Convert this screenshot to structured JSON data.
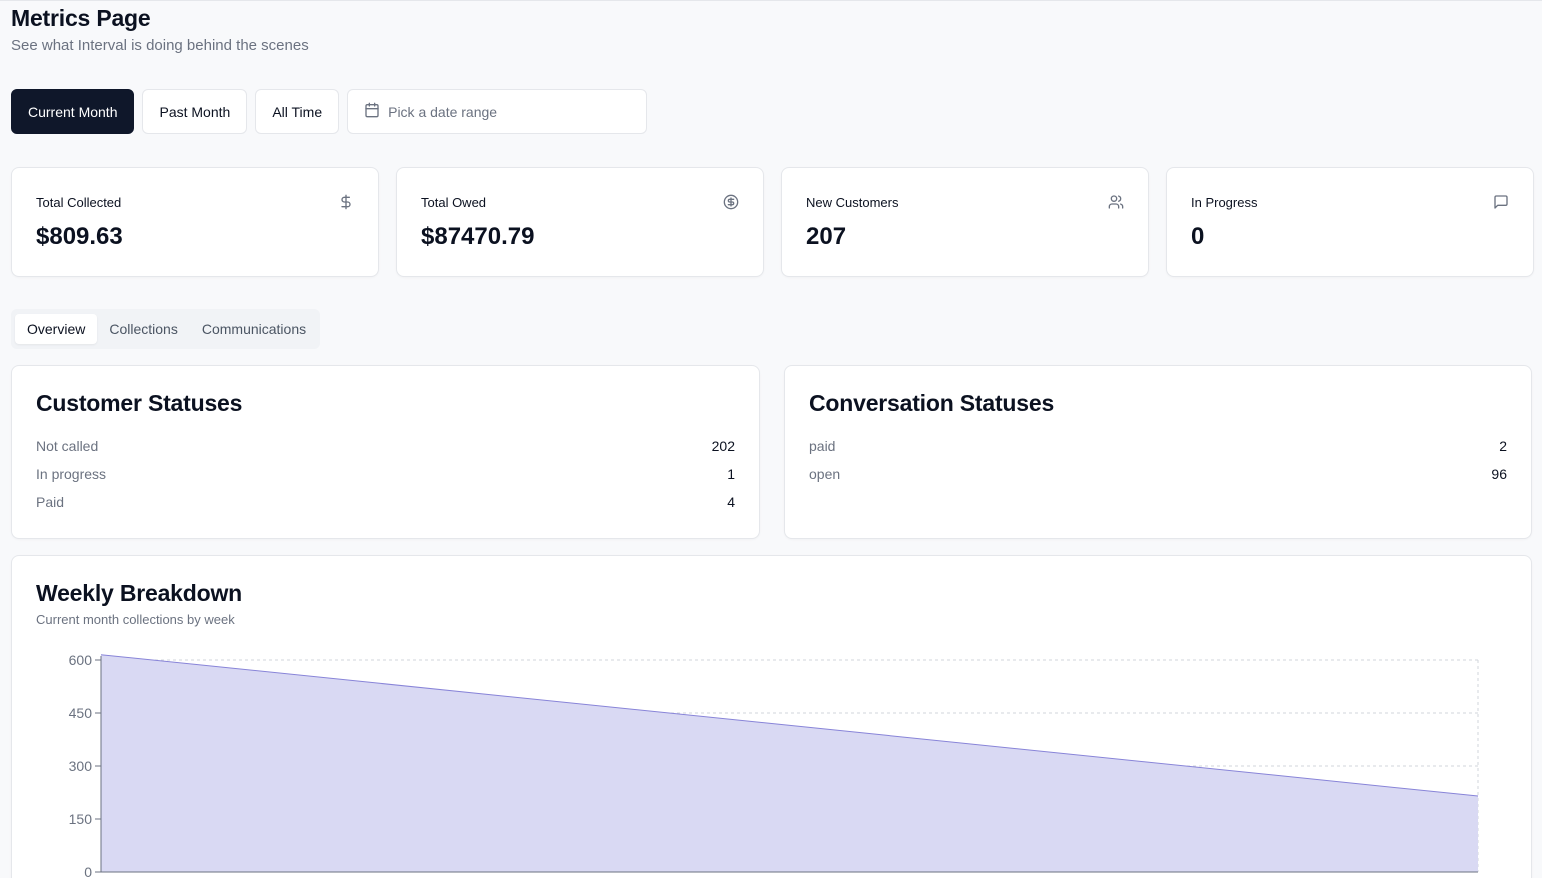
{
  "header": {
    "title": "Metrics Page",
    "subtitle": "See what Interval is doing behind the scenes"
  },
  "filters": {
    "current_month": "Current Month",
    "past_month": "Past Month",
    "all_time": "All Time",
    "date_range_placeholder": "Pick a date range",
    "active": "current_month"
  },
  "stats": [
    {
      "label": "Total Collected",
      "value": "$809.63",
      "icon": "dollar-icon"
    },
    {
      "label": "Total Owed",
      "value": "$87470.79",
      "icon": "dollar-circle-icon"
    },
    {
      "label": "New Customers",
      "value": "207",
      "icon": "users-icon"
    },
    {
      "label": "In Progress",
      "value": "0",
      "icon": "message-square-icon"
    }
  ],
  "tabs": [
    {
      "label": "Overview",
      "active": true
    },
    {
      "label": "Collections",
      "active": false
    },
    {
      "label": "Communications",
      "active": false
    }
  ],
  "customer_statuses": {
    "title": "Customer Statuses",
    "rows": [
      {
        "label": "Not called",
        "value": "202"
      },
      {
        "label": "In progress",
        "value": "1"
      },
      {
        "label": "Paid",
        "value": "4"
      }
    ]
  },
  "conversation_statuses": {
    "title": "Conversation Statuses",
    "rows": [
      {
        "label": "paid",
        "value": "2"
      },
      {
        "label": "open",
        "value": "96"
      }
    ]
  },
  "weekly": {
    "title": "Weekly Breakdown",
    "subtitle": "Current month collections by week"
  },
  "chart_data": {
    "type": "area",
    "x": [
      0,
      1
    ],
    "series": [
      {
        "values": [
          615,
          215
        ]
      }
    ],
    "yticks": [
      0,
      150,
      300,
      450,
      600
    ],
    "ylim": [
      0,
      600
    ],
    "grid": true,
    "fill_color": "#d9d9f3",
    "line_color": "#8884d8"
  }
}
